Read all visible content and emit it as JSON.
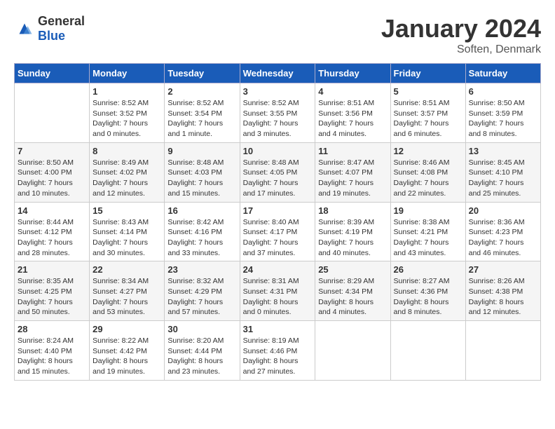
{
  "header": {
    "logo_general": "General",
    "logo_blue": "Blue",
    "month": "January 2024",
    "location": "Soften, Denmark"
  },
  "weekdays": [
    "Sunday",
    "Monday",
    "Tuesday",
    "Wednesday",
    "Thursday",
    "Friday",
    "Saturday"
  ],
  "weeks": [
    [
      {
        "day": "",
        "sunrise": "",
        "sunset": "",
        "daylight": ""
      },
      {
        "day": "1",
        "sunrise": "8:52 AM",
        "sunset": "3:52 PM",
        "daylight": "7 hours and 0 minutes."
      },
      {
        "day": "2",
        "sunrise": "8:52 AM",
        "sunset": "3:54 PM",
        "daylight": "7 hours and 1 minute."
      },
      {
        "day": "3",
        "sunrise": "8:52 AM",
        "sunset": "3:55 PM",
        "daylight": "7 hours and 3 minutes."
      },
      {
        "day": "4",
        "sunrise": "8:51 AM",
        "sunset": "3:56 PM",
        "daylight": "7 hours and 4 minutes."
      },
      {
        "day": "5",
        "sunrise": "8:51 AM",
        "sunset": "3:57 PM",
        "daylight": "7 hours and 6 minutes."
      },
      {
        "day": "6",
        "sunrise": "8:50 AM",
        "sunset": "3:59 PM",
        "daylight": "7 hours and 8 minutes."
      }
    ],
    [
      {
        "day": "7",
        "sunrise": "8:50 AM",
        "sunset": "4:00 PM",
        "daylight": "7 hours and 10 minutes."
      },
      {
        "day": "8",
        "sunrise": "8:49 AM",
        "sunset": "4:02 PM",
        "daylight": "7 hours and 12 minutes."
      },
      {
        "day": "9",
        "sunrise": "8:48 AM",
        "sunset": "4:03 PM",
        "daylight": "7 hours and 15 minutes."
      },
      {
        "day": "10",
        "sunrise": "8:48 AM",
        "sunset": "4:05 PM",
        "daylight": "7 hours and 17 minutes."
      },
      {
        "day": "11",
        "sunrise": "8:47 AM",
        "sunset": "4:07 PM",
        "daylight": "7 hours and 19 minutes."
      },
      {
        "day": "12",
        "sunrise": "8:46 AM",
        "sunset": "4:08 PM",
        "daylight": "7 hours and 22 minutes."
      },
      {
        "day": "13",
        "sunrise": "8:45 AM",
        "sunset": "4:10 PM",
        "daylight": "7 hours and 25 minutes."
      }
    ],
    [
      {
        "day": "14",
        "sunrise": "8:44 AM",
        "sunset": "4:12 PM",
        "daylight": "7 hours and 28 minutes."
      },
      {
        "day": "15",
        "sunrise": "8:43 AM",
        "sunset": "4:14 PM",
        "daylight": "7 hours and 30 minutes."
      },
      {
        "day": "16",
        "sunrise": "8:42 AM",
        "sunset": "4:16 PM",
        "daylight": "7 hours and 33 minutes."
      },
      {
        "day": "17",
        "sunrise": "8:40 AM",
        "sunset": "4:17 PM",
        "daylight": "7 hours and 37 minutes."
      },
      {
        "day": "18",
        "sunrise": "8:39 AM",
        "sunset": "4:19 PM",
        "daylight": "7 hours and 40 minutes."
      },
      {
        "day": "19",
        "sunrise": "8:38 AM",
        "sunset": "4:21 PM",
        "daylight": "7 hours and 43 minutes."
      },
      {
        "day": "20",
        "sunrise": "8:36 AM",
        "sunset": "4:23 PM",
        "daylight": "7 hours and 46 minutes."
      }
    ],
    [
      {
        "day": "21",
        "sunrise": "8:35 AM",
        "sunset": "4:25 PM",
        "daylight": "7 hours and 50 minutes."
      },
      {
        "day": "22",
        "sunrise": "8:34 AM",
        "sunset": "4:27 PM",
        "daylight": "7 hours and 53 minutes."
      },
      {
        "day": "23",
        "sunrise": "8:32 AM",
        "sunset": "4:29 PM",
        "daylight": "7 hours and 57 minutes."
      },
      {
        "day": "24",
        "sunrise": "8:31 AM",
        "sunset": "4:31 PM",
        "daylight": "8 hours and 0 minutes."
      },
      {
        "day": "25",
        "sunrise": "8:29 AM",
        "sunset": "4:34 PM",
        "daylight": "8 hours and 4 minutes."
      },
      {
        "day": "26",
        "sunrise": "8:27 AM",
        "sunset": "4:36 PM",
        "daylight": "8 hours and 8 minutes."
      },
      {
        "day": "27",
        "sunrise": "8:26 AM",
        "sunset": "4:38 PM",
        "daylight": "8 hours and 12 minutes."
      }
    ],
    [
      {
        "day": "28",
        "sunrise": "8:24 AM",
        "sunset": "4:40 PM",
        "daylight": "8 hours and 15 minutes."
      },
      {
        "day": "29",
        "sunrise": "8:22 AM",
        "sunset": "4:42 PM",
        "daylight": "8 hours and 19 minutes."
      },
      {
        "day": "30",
        "sunrise": "8:20 AM",
        "sunset": "4:44 PM",
        "daylight": "8 hours and 23 minutes."
      },
      {
        "day": "31",
        "sunrise": "8:19 AM",
        "sunset": "4:46 PM",
        "daylight": "8 hours and 27 minutes."
      },
      {
        "day": "",
        "sunrise": "",
        "sunset": "",
        "daylight": ""
      },
      {
        "day": "",
        "sunrise": "",
        "sunset": "",
        "daylight": ""
      },
      {
        "day": "",
        "sunrise": "",
        "sunset": "",
        "daylight": ""
      }
    ]
  ]
}
